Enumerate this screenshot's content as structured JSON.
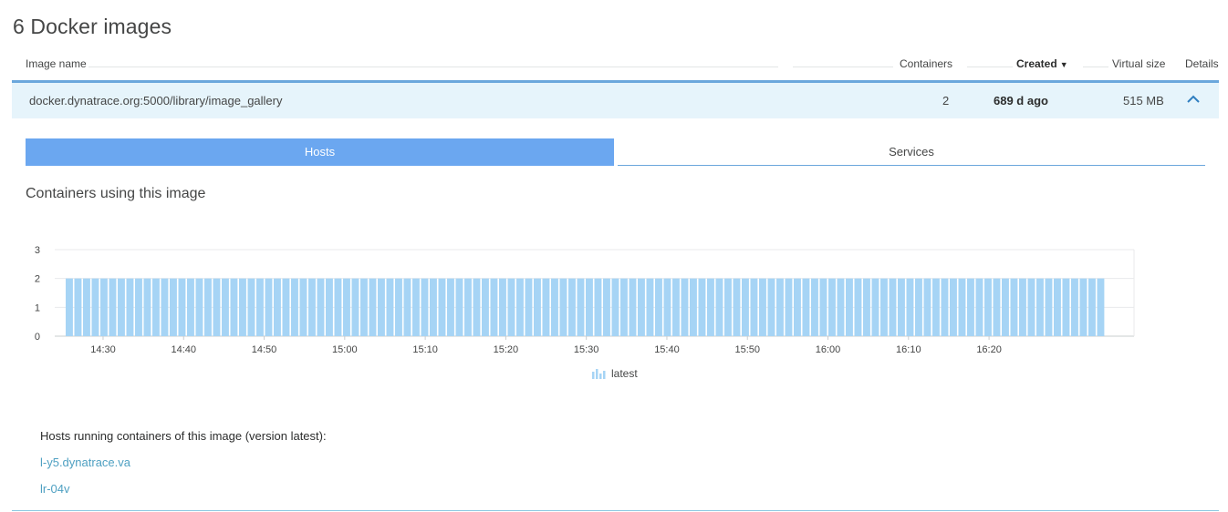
{
  "page": {
    "title": "6 Docker images"
  },
  "table": {
    "headers": {
      "image_name": "Image name",
      "containers": "Containers",
      "created": "Created",
      "virtual_size": "Virtual size",
      "details": "Details"
    },
    "sort_icon": "▼",
    "row": {
      "image_name": "docker.dynatrace.org:5000/library/image_gallery",
      "containers": "2",
      "created": "689 d ago",
      "virtual_size": "515 MB",
      "expanded": true
    }
  },
  "tabs": [
    {
      "label": "Hosts",
      "active": true
    },
    {
      "label": "Services",
      "active": false
    }
  ],
  "section": {
    "title": "Containers using this image"
  },
  "chart_data": {
    "type": "bar",
    "y_ticks": [
      "3",
      "2",
      "1",
      "0"
    ],
    "ylim": [
      0,
      3
    ],
    "x_ticks": [
      "14:30",
      "14:40",
      "14:50",
      "15:00",
      "15:10",
      "15:20",
      "15:30",
      "15:40",
      "15:50",
      "16:00",
      "16:10",
      "16:20"
    ],
    "x_range_minutes": [
      "14:24",
      "16:38"
    ],
    "bar_count": 120,
    "series": [
      {
        "name": "latest",
        "color": "#a6d4f5",
        "value_constant": 2
      }
    ],
    "legend": {
      "label": "latest",
      "placement": "bottom-center"
    },
    "grid": true
  },
  "hosts": {
    "title": "Hosts running containers of this image (version latest):",
    "items": [
      "l-y5.dynatrace.va",
      "lr-04v"
    ]
  },
  "colors": {
    "accent": "#6ba7f0",
    "row_bg": "#e6f4fb",
    "link": "#4fa0c2",
    "bar": "#a6d4f5"
  }
}
